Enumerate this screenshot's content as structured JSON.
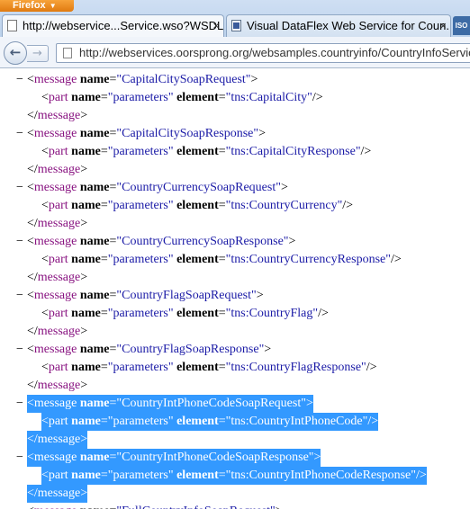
{
  "browser": {
    "menu_label": "Firefox",
    "tabs": [
      {
        "title": "http://webservice...Service.wso?WSDL",
        "close": "×"
      },
      {
        "title": "Visual DataFlex Web Service for Coun...",
        "close": "×"
      }
    ],
    "extra_badge": "ISO",
    "back_glyph": "←",
    "forward_glyph": "→",
    "url": "http://webservices.oorsprong.org/websamples.countryinfo/CountryInfoService.wso?WSDL"
  },
  "xml": {
    "collapse_glyph": "−",
    "message_tag": "message",
    "part_tag": "part",
    "name_attr": "name",
    "element_attr": "element",
    "parameters_value": "parameters",
    "blocks": [
      {
        "message": "CapitalCitySoapRequest",
        "element": "tns:CapitalCity"
      },
      {
        "message": "CapitalCitySoapResponse",
        "element": "tns:CapitalCityResponse"
      },
      {
        "message": "CountryCurrencySoapRequest",
        "element": "tns:CountryCurrency"
      },
      {
        "message": "CountryCurrencySoapResponse",
        "element": "tns:CountryCurrencyResponse"
      },
      {
        "message": "CountryFlagSoapRequest",
        "element": "tns:CountryFlag"
      },
      {
        "message": "CountryFlagSoapResponse",
        "element": "tns:CountryFlagResponse"
      },
      {
        "message": "CountryIntPhoneCodeSoapRequest",
        "element": "tns:CountryIntPhoneCode"
      },
      {
        "message": "CountryIntPhoneCodeSoapResponse",
        "element": "tns:CountryIntPhoneCodeResponse"
      }
    ],
    "partial_message": "FullCountryInfoSoapRequest"
  }
}
